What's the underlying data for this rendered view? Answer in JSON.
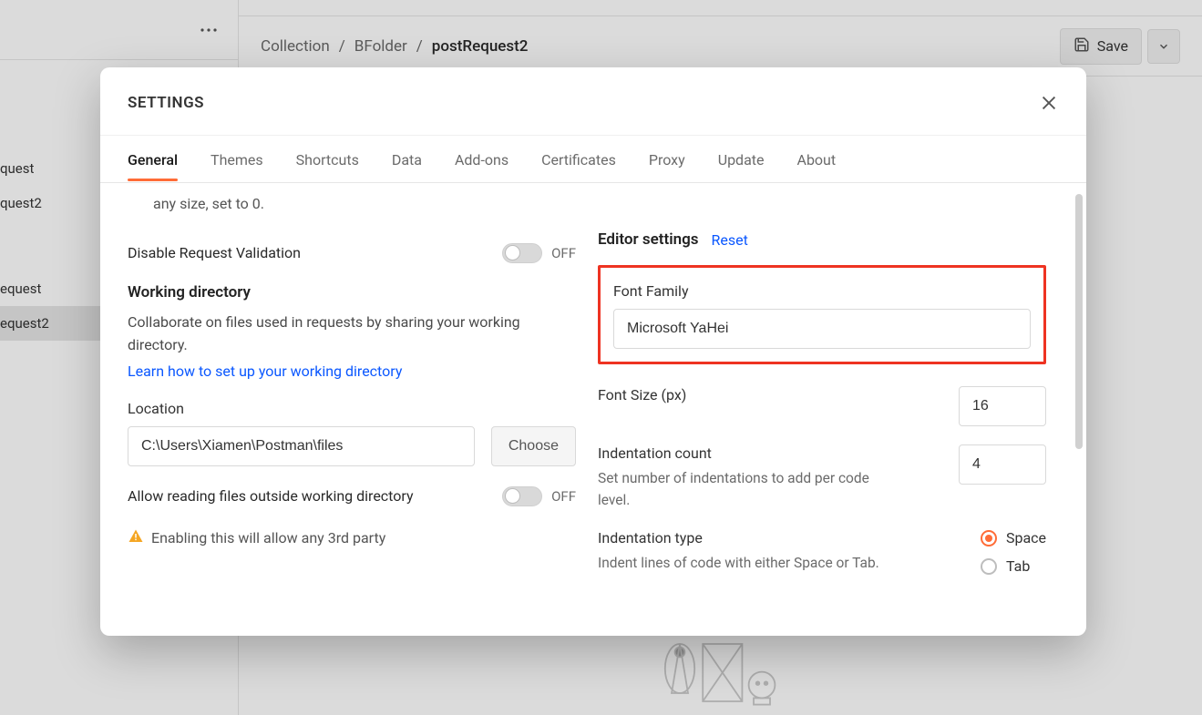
{
  "breadcrumb": {
    "a": "Collection",
    "b": "BFolder",
    "c": "postRequest2"
  },
  "save_label": "Save",
  "sidebar": {
    "items": [
      "quest",
      "quest2",
      "equest",
      "equest2"
    ]
  },
  "modal": {
    "title": "SETTINGS",
    "tabs": [
      "General",
      "Themes",
      "Shortcuts",
      "Data",
      "Add-ons",
      "Certificates",
      "Proxy",
      "Update",
      "About"
    ],
    "active_tab": 0
  },
  "left": {
    "truncated_top": "any size, set to 0.",
    "disable_req": "Disable Request Validation",
    "off": "OFF",
    "workdir_h": "Working directory",
    "workdir_help": "Collaborate on files used in requests by sharing your working directory.",
    "workdir_link": "Learn how to set up your working directory",
    "location_label": "Location",
    "location_value": "C:\\Users\\Xiamen\\Postman\\files",
    "choose": "Choose",
    "allow_read": "Allow reading files outside working directory",
    "warn_text": "Enabling this will allow any 3rd party"
  },
  "right": {
    "editor_h": "Editor settings",
    "reset": "Reset",
    "font_family_label": "Font Family",
    "font_family_value": "Microsoft YaHei",
    "font_size_label": "Font Size (px)",
    "font_size_value": "16",
    "indent_count_label": "Indentation count",
    "indent_count_value": "4",
    "indent_count_help": "Set number of indentations to add per code level.",
    "indent_type_label": "Indentation type",
    "indent_type_help": "Indent lines of code with either Space or Tab.",
    "indent_space": "Space",
    "indent_tab": "Tab"
  }
}
